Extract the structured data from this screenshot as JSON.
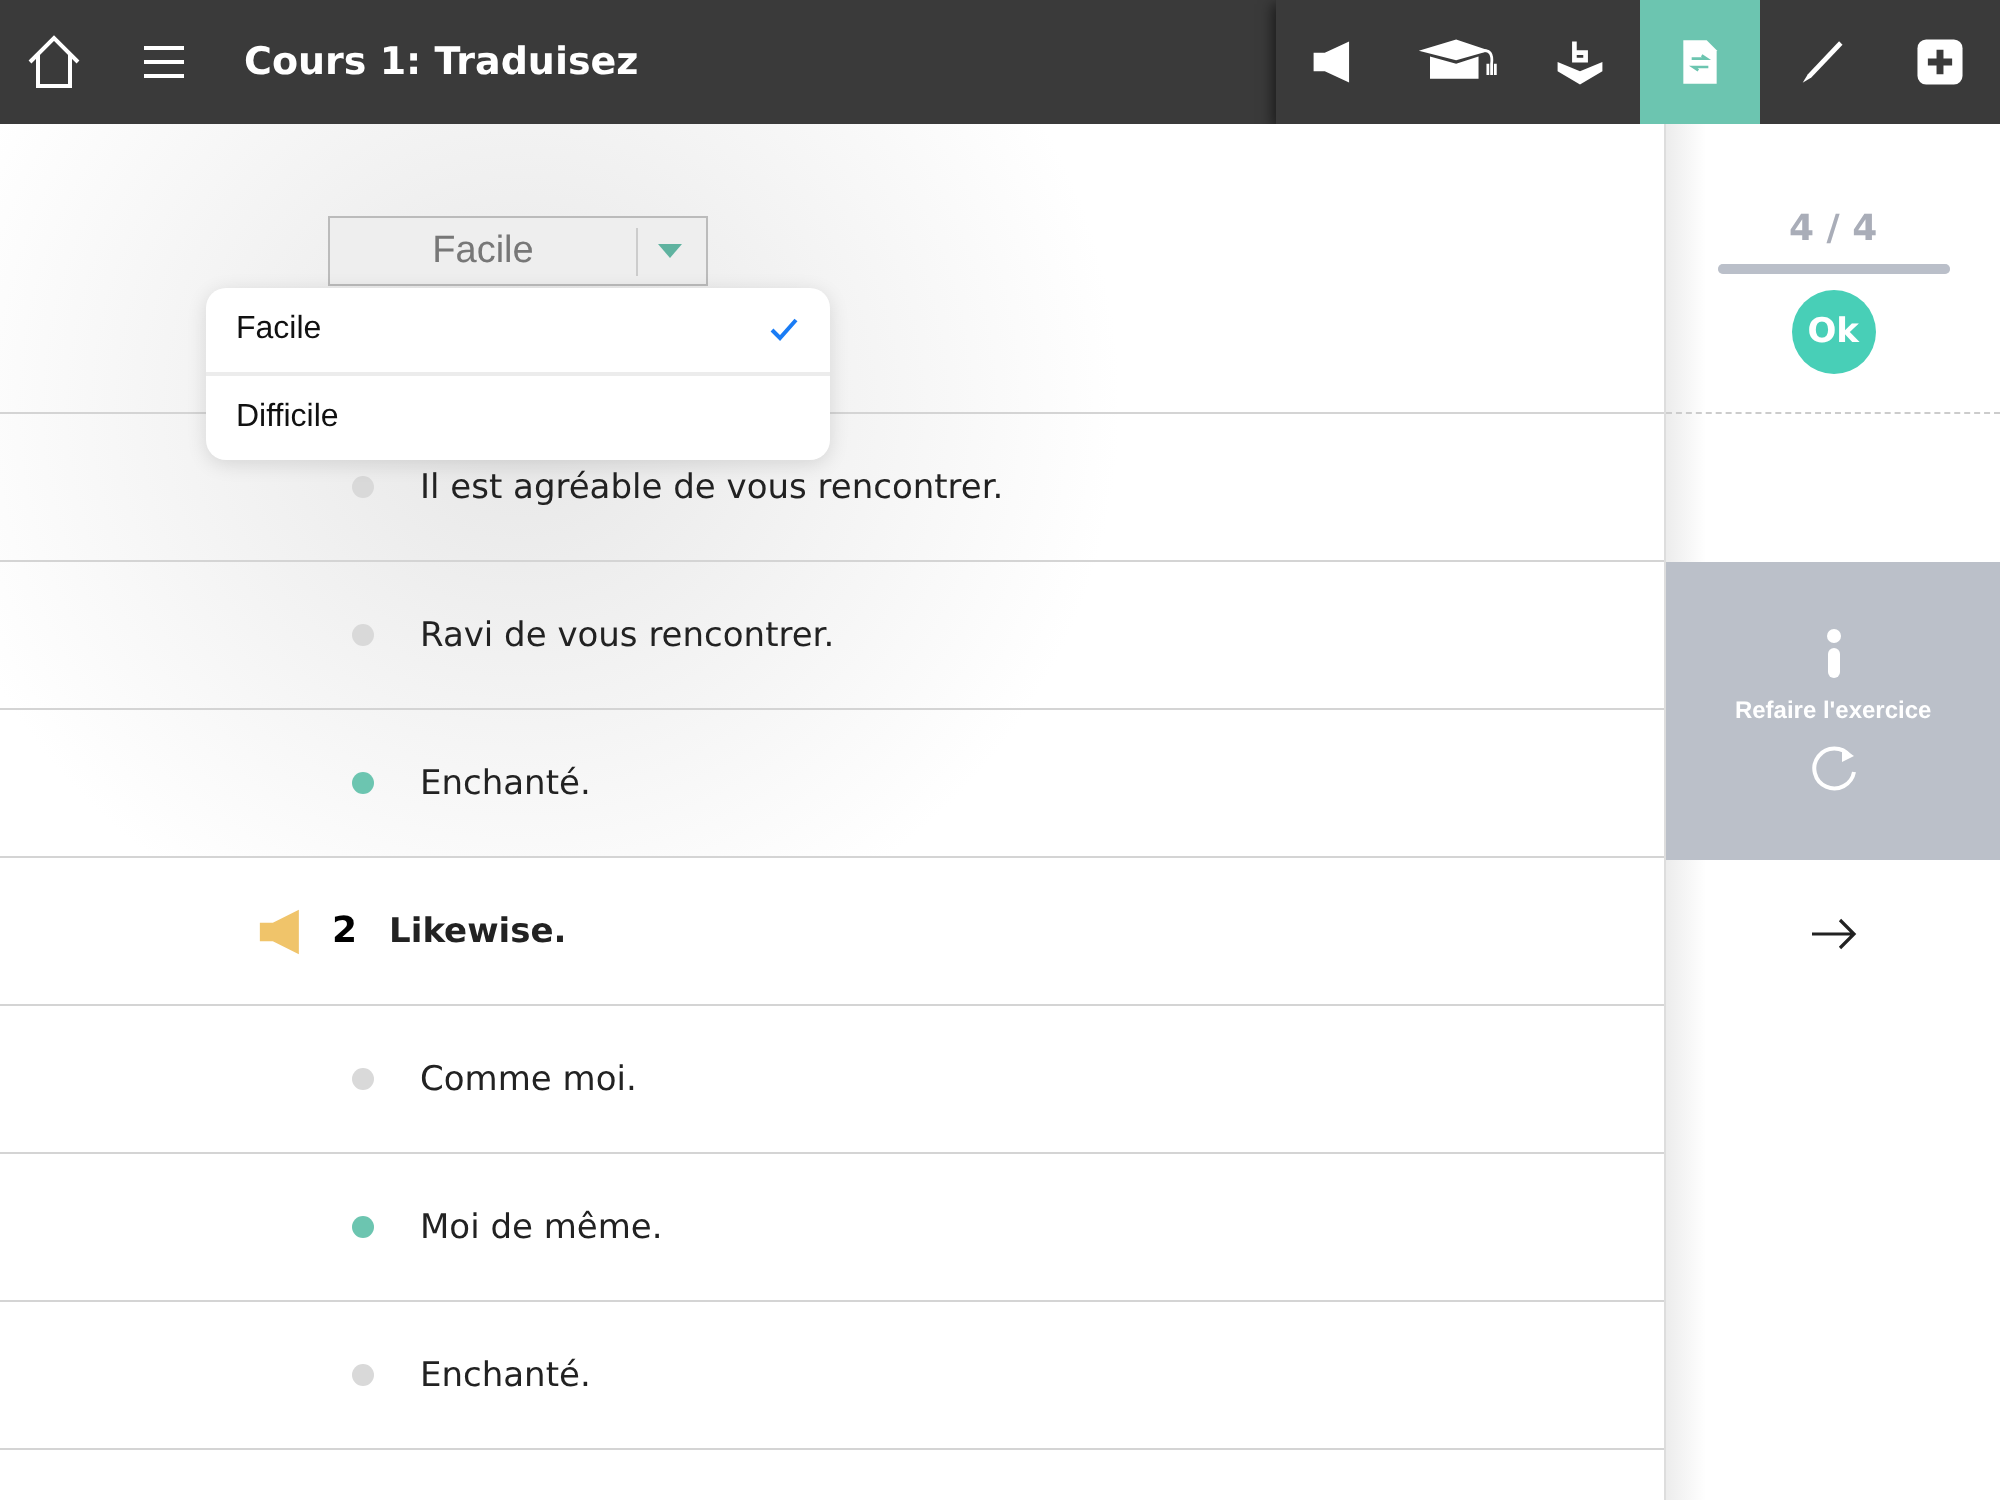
{
  "header": {
    "title": "Cours 1: Traduisez"
  },
  "toolbar": [
    {
      "kind": "speaker",
      "selected": false
    },
    {
      "kind": "cap",
      "selected": false
    },
    {
      "kind": "box",
      "selected": false
    },
    {
      "kind": "document",
      "selected": true
    },
    {
      "kind": "pen",
      "selected": false
    },
    {
      "kind": "plus",
      "selected": false
    }
  ],
  "level_select": {
    "value": "Facile"
  },
  "level_menu": [
    {
      "label": "Facile",
      "selected": true
    },
    {
      "label": "Difficile",
      "selected": false
    }
  ],
  "rows": [
    {
      "kind": "answer",
      "text": "Il est agréable de vous rencontrer.",
      "color": "#d9d9d9"
    },
    {
      "kind": "answer",
      "text": "Ravi de vous rencontrer.",
      "color": "#d9d9d9"
    },
    {
      "kind": "answer",
      "text": "Enchanté.",
      "color": "#6cc5b0"
    },
    {
      "kind": "prompt",
      "number": "2",
      "text": "Likewise."
    },
    {
      "kind": "answer",
      "text": "Comme moi.",
      "color": "#d9d9d9"
    },
    {
      "kind": "answer",
      "text": "Moi de même.",
      "color": "#6cc5b0"
    },
    {
      "kind": "answer",
      "text": "Enchanté.",
      "color": "#d9d9d9"
    }
  ],
  "progress": {
    "text": "4 / 4",
    "level": 1.0
  },
  "ok_button": {
    "label": "Ok"
  },
  "redo_panel": {
    "label": "Refaire l'exercice"
  }
}
